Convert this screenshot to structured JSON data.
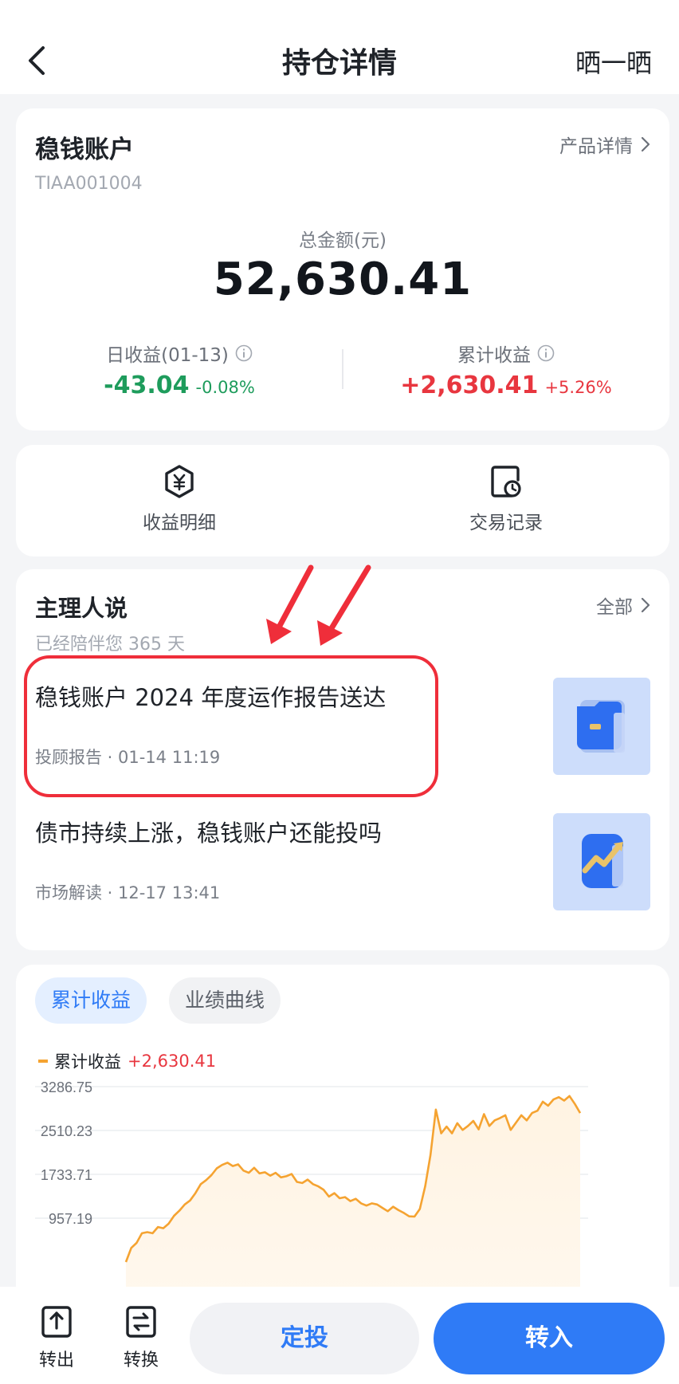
{
  "header": {
    "title": "持仓详情",
    "share_label": "晒一晒"
  },
  "account": {
    "name": "稳钱账户",
    "code": "TIAA001004",
    "product_link": "产品详情",
    "total_label": "总金额(元)",
    "total_value": "52,630.41",
    "daily": {
      "label": "日收益(01-13)",
      "value": "-43.04",
      "pct": "-0.08%"
    },
    "cumulative": {
      "label": "累计收益",
      "value": "+2,630.41",
      "pct": "+5.26%"
    }
  },
  "quick_actions": [
    {
      "label": "收益明细",
      "icon": "yuan-shield-icon"
    },
    {
      "label": "交易记录",
      "icon": "document-clock-icon"
    }
  ],
  "manager": {
    "title": "主理人说",
    "all_link": "全部",
    "companion": "已经陪伴您 365 天",
    "articles": [
      {
        "title": "稳钱账户 2024 年度运作报告送达",
        "meta": "投顾报告 · 01-14 11:19",
        "thumb": "folder-icon"
      },
      {
        "title": "债市持续上涨，稳钱账户还能投吗",
        "meta": "市场解读 · 12-17 13:41",
        "thumb": "trend-up-icon"
      }
    ]
  },
  "chart_tabs": {
    "active": "累计收益",
    "inactive": "业绩曲线"
  },
  "colors": {
    "accent": "#2f7bf6",
    "gain": "#e8363f",
    "loss": "#1e9c5c",
    "line": "#f5a331",
    "annotation": "#ef2e3a"
  },
  "chart_data": {
    "type": "area",
    "legend": {
      "label": "累计收益",
      "value": "+2,630.41"
    },
    "y_ticks": [
      "3286.75",
      "2510.23",
      "1733.71",
      "957.19"
    ],
    "ylim": [
      180,
      3286.75
    ],
    "grid": true,
    "series": [
      {
        "name": "累计收益",
        "values": [
          180,
          430,
          520,
          690,
          710,
          690,
          800,
          780,
          860,
          1000,
          1090,
          1200,
          1270,
          1400,
          1560,
          1630,
          1720,
          1840,
          1900,
          1940,
          1880,
          1910,
          1800,
          1760,
          1850,
          1750,
          1770,
          1710,
          1760,
          1680,
          1700,
          1740,
          1600,
          1580,
          1640,
          1560,
          1520,
          1460,
          1340,
          1400,
          1310,
          1330,
          1260,
          1300,
          1220,
          1180,
          1220,
          1200,
          1140,
          1080,
          1160,
          1100,
          1050,
          990,
          985,
          1120,
          1520,
          2080,
          2880,
          2460,
          2580,
          2460,
          2640,
          2520,
          2590,
          2680,
          2530,
          2800,
          2590,
          2690,
          2730,
          2780,
          2520,
          2650,
          2780,
          2690,
          2820,
          2860,
          3020,
          2950,
          3060,
          3100,
          3040,
          3120,
          2980,
          2820
        ]
      }
    ]
  },
  "bottom_bar": {
    "out_label": "转出",
    "switch_label": "转换",
    "plan_button": "定投",
    "in_button": "转入"
  }
}
